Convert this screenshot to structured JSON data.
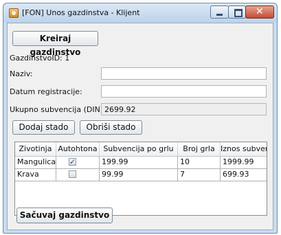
{
  "window": {
    "title": "[FON] Unos gazdinstva - Klijent"
  },
  "form": {
    "create_button": "Kreiraj gazdinstvo",
    "id_label": "GazdinstvoID:",
    "id_value": "1",
    "naziv_label": "Naziv:",
    "naziv_value": "",
    "datum_label": "Datum registracije:",
    "datum_value": "",
    "subvencija_label": "Ukupno subvencija (DIN):",
    "subvencija_value": "2699.92",
    "add_herd_button": "Dodaj stado",
    "remove_herd_button": "Obriši stado",
    "save_button": "Sačuvaj gazdinstvo"
  },
  "table": {
    "headers": [
      "Zivotinja",
      "Autohtona",
      "Subvencija po grlu",
      "Broj grla",
      "Iznos subvenije"
    ],
    "rows": [
      {
        "zivotinja": "Mangulica",
        "autohtona": true,
        "subvencija": "199.99",
        "broj": "10",
        "iznos": "1999.99"
      },
      {
        "zivotinja": "Krava",
        "autohtona": false,
        "subvencija": "99.99",
        "broj": "7",
        "iznos": "699.93"
      }
    ]
  }
}
